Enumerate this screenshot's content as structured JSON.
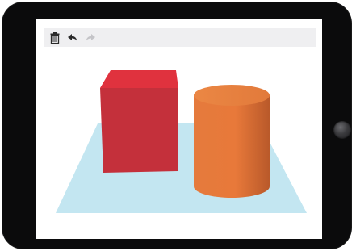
{
  "toolbar": {
    "buttons": [
      {
        "name": "delete",
        "icon": "trash-icon",
        "enabled": true
      },
      {
        "name": "undo",
        "icon": "undo-arrow-icon",
        "enabled": true
      },
      {
        "name": "redo",
        "icon": "redo-arrow-icon",
        "enabled": false
      }
    ]
  },
  "scene": {
    "objects": [
      {
        "type": "cube",
        "color": "#c4303b"
      },
      {
        "type": "cylinder",
        "color": "#e8793a"
      }
    ],
    "ground_color": "#c3e6f1"
  },
  "colors": {
    "device_frame": "#0b0b0c",
    "toolbar_bg": "#efeff1",
    "icon_active": "#2a2a2a",
    "icon_disabled": "#c4c4c8"
  }
}
